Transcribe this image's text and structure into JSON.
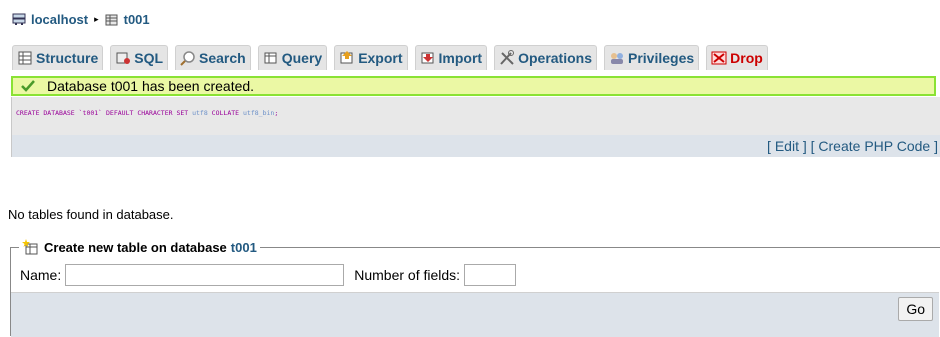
{
  "breadcrumb": {
    "server": "localhost",
    "separator": "▸",
    "database": "t001"
  },
  "tabs": [
    {
      "label": "Structure",
      "icon": "structure-icon"
    },
    {
      "label": "SQL",
      "icon": "sql-icon"
    },
    {
      "label": "Search",
      "icon": "search-icon"
    },
    {
      "label": "Query",
      "icon": "query-icon"
    },
    {
      "label": "Export",
      "icon": "export-icon"
    },
    {
      "label": "Import",
      "icon": "import-icon"
    },
    {
      "label": "Operations",
      "icon": "operations-icon"
    },
    {
      "label": "Privileges",
      "icon": "privileges-icon"
    },
    {
      "label": "Drop",
      "icon": "drop-icon"
    }
  ],
  "message": {
    "text": "Database t001 has been created.",
    "icon": "check-icon"
  },
  "sql": {
    "part1": "CREATE DATABASE `t001` DEFAULT CHARACTER SET ",
    "charset": "utf8",
    "part2": " COLLATE ",
    "collation": "utf8_bin",
    "part3": ";"
  },
  "sql_links": {
    "open": "[ ",
    "edit": "Edit",
    "mid": " ] [ ",
    "php": "Create PHP Code",
    "close": " ]"
  },
  "no_tables": "No tables found in database.",
  "create_table": {
    "legend": "Create new table on database",
    "database": "t001",
    "name_label": "Name:",
    "name_value": "",
    "fields_label": "Number of fields:",
    "fields_value": "",
    "go_label": "Go"
  },
  "colors": {
    "link": "#235a81",
    "drop": "#cc0000",
    "success_border": "#8ae234",
    "success_bg": "#ebf8a4"
  }
}
